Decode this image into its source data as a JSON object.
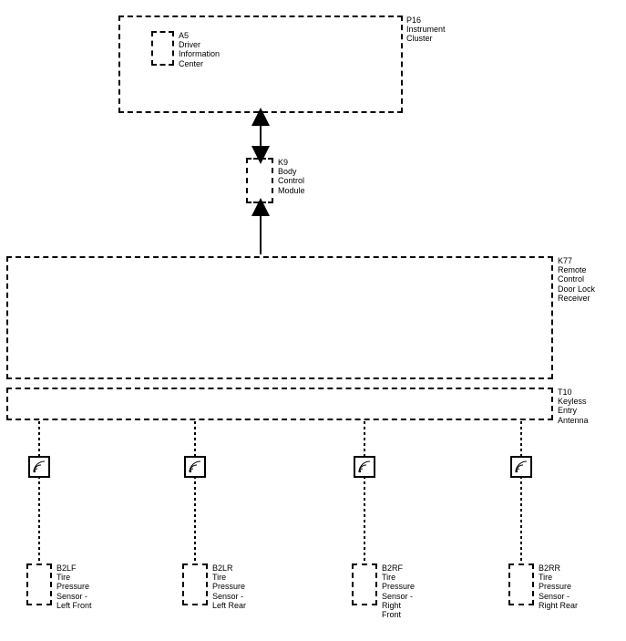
{
  "blocks": {
    "p16": {
      "code": "P16",
      "name": "Instrument\nCluster"
    },
    "a5": {
      "code": "A5",
      "name": "Driver\nInformation\nCenter"
    },
    "k9": {
      "code": "K9",
      "name": "Body\nControl\nModule"
    },
    "k77": {
      "code": "K77",
      "name": "Remote\nControl\nDoor Lock\nReceiver"
    },
    "t10": {
      "code": "T10",
      "name": "Keyless\nEntry\nAntenna"
    },
    "b2lf": {
      "code": "B2LF",
      "name": "Tire\nPressure\nSensor -\nLeft Front"
    },
    "b2lr": {
      "code": "B2LR",
      "name": "Tire\nPressure\nSensor -\nLeft Rear"
    },
    "b2rf": {
      "code": "B2RF",
      "name": "Tire\nPressure\nSensor -\nRight\nFront"
    },
    "b2rr": {
      "code": "B2RR",
      "name": "Tire\nPressure\nSensor -\nRight Rear"
    }
  }
}
